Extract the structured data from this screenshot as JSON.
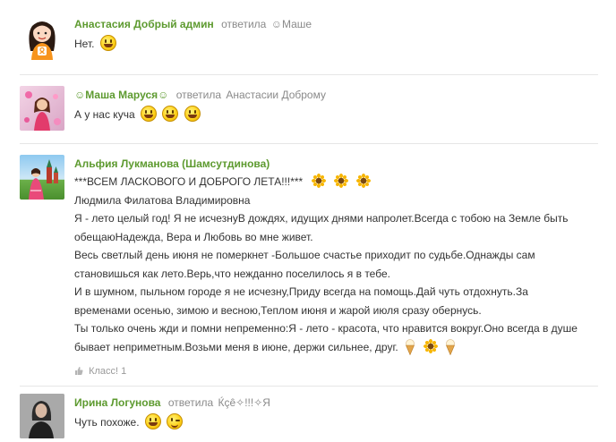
{
  "comments": [
    {
      "author": "Анастасия Добрый админ",
      "reply_label": "ответила",
      "reply_to": "☺Маше",
      "text": "Нет."
    },
    {
      "author": "☺Маша Маруся☺",
      "reply_label": "ответила",
      "reply_to": "Анастасии Доброму",
      "text": "А у нас куча"
    },
    {
      "author": "Альфия Лукманова (Шамсутдинова)",
      "lines": [
        "***ВСЕМ ЛАСКОВОГО И ДОБРОГО ЛЕТА!!!***",
        "Людмила Филатова Владимировна",
        "Я - лето целый год! Я не исчезнуВ дождях, идущих днями напролет.Всегда с тобою на Земле быть",
        "обещаюНадежда, Вера и Любовь во мне живет.",
        "Весь светлый день июня не померкнет -Большое счастье приходит по судьбе.Однажды сам",
        "становишься как лето.Верь,что нежданно поселилось я в тебе.",
        "И в шумном, пыльном городе я не исчезну,Приду всегда на помощь.Дай чуть отдохнуть.За",
        "временами осенью, зимою и весною,Теплом июня и жарой июля сразу обернусь.",
        "Ты только очень жди и помни непременно:Я - лето - красота, что нравится вокруг.Оно всегда в душе",
        "бывает неприметным.Возьми меня в июне, держи сильнее, друг."
      ],
      "like_label": "Класс! 1"
    },
    {
      "author": "Ирина Логунова",
      "reply_label": "ответила",
      "reply_to": "Ќçê✧!!!✧Я",
      "text": "Чуть похоже."
    }
  ]
}
